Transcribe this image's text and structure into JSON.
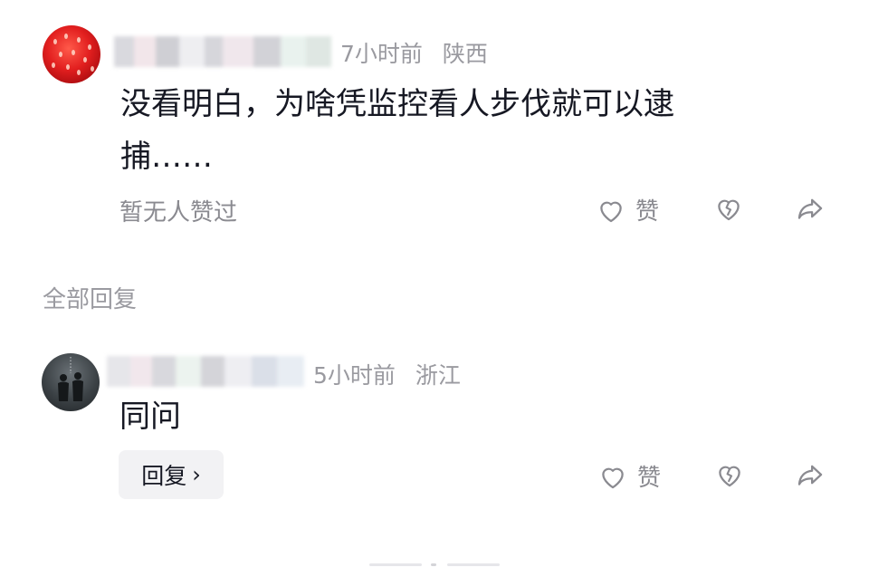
{
  "comment": {
    "time": "7小时前",
    "location": "陕西",
    "text_line1": "没看明白，为啥凭监控看人步伐就可以逮",
    "text_line2": "捕……",
    "likes_status": "暂无人赞过",
    "like_label": "赞"
  },
  "replies_section": {
    "title": "全部回复"
  },
  "reply": {
    "time": "5小时前",
    "location": "浙江",
    "text": "同问",
    "reply_button": "回复",
    "reply_chevron": "›",
    "like_label": "赞"
  },
  "colors": {
    "text_primary": "#161823",
    "text_muted": "#8a8a90",
    "reply_button_bg": "#f2f2f4"
  },
  "icons": [
    "heart-outline-icon",
    "broken-heart-icon",
    "share-arrow-icon",
    "chevron-right-icon"
  ]
}
